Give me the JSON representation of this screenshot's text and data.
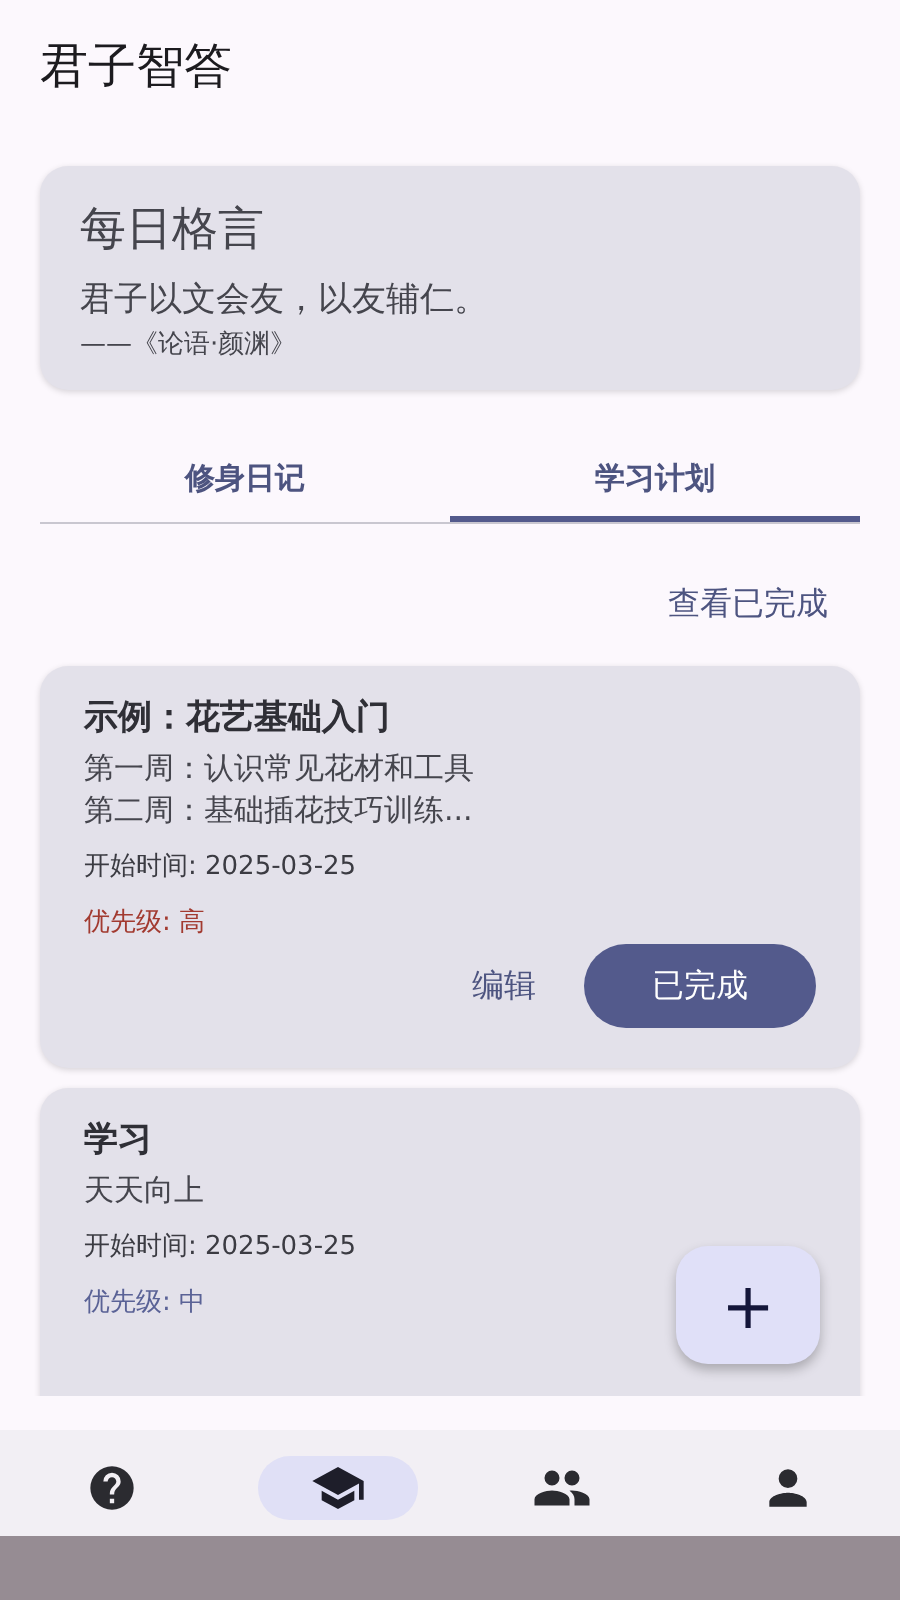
{
  "app_title": "君子智答",
  "quote_card": {
    "title": "每日格言",
    "quote": "君子以文会友，以友辅仁。",
    "source": "——《论语·颜渊》"
  },
  "tabs": [
    {
      "label": "修身日记",
      "selected": false
    },
    {
      "label": "学习计划",
      "selected": true
    }
  ],
  "view_completed_link": "查看已完成",
  "plans": [
    {
      "title": "示例：花艺基础入门",
      "description_lines": [
        "第一周：认识常见花材和工具",
        "第二周：基础插花技巧训练..."
      ],
      "start_time": "开始时间: 2025-03-25",
      "priority": "优先级: 高",
      "color": "#a23a30",
      "edit_label": "编辑",
      "complete_label": "已完成"
    },
    {
      "title": "学习",
      "description_lines": [
        "天天向上"
      ],
      "start_time": "开始时间: 2025-03-25",
      "priority": "优先级: 中",
      "color": "#5a6296"
    }
  ],
  "fab": {
    "label": "+"
  },
  "bottom_nav": [
    {
      "kind": "help",
      "selected": false
    },
    {
      "kind": "school",
      "selected": true
    },
    {
      "kind": "people",
      "selected": false
    },
    {
      "kind": "person",
      "selected": false
    }
  ]
}
